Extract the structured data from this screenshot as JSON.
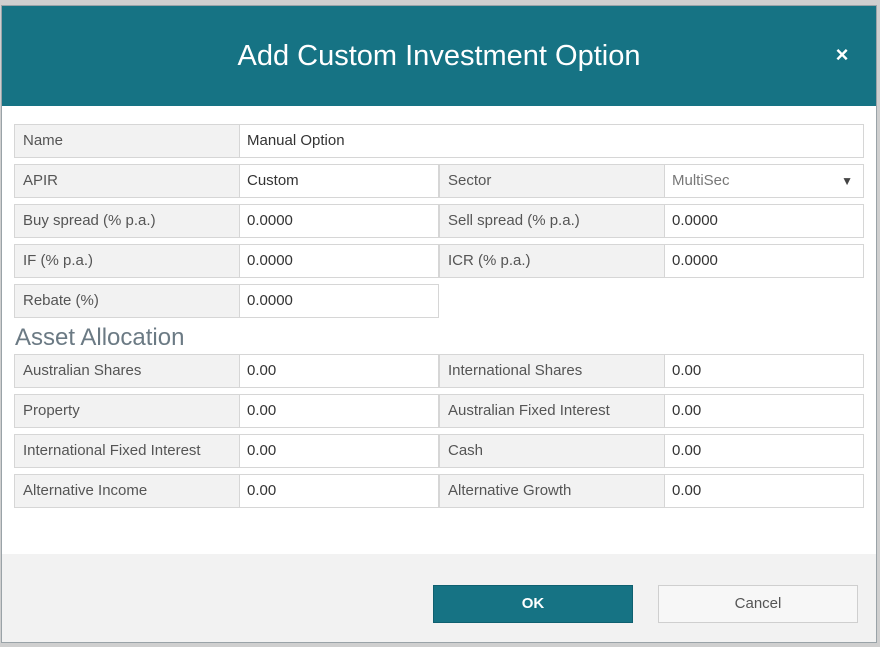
{
  "dialog": {
    "title": "Add Custom Investment Option",
    "close_glyph": "×"
  },
  "details": {
    "name": {
      "label": "Name",
      "value": "Manual Option"
    },
    "apir": {
      "label": "APIR",
      "value": "Custom"
    },
    "sector": {
      "label": "Sector",
      "value": "MultiSec",
      "caret": "▼"
    },
    "buy_spread": {
      "label": "Buy spread (% p.a.)",
      "value": "0.0000"
    },
    "sell_spread": {
      "label": "Sell spread (% p.a.)",
      "value": "0.0000"
    },
    "if": {
      "label": "IF (% p.a.)",
      "value": "0.0000"
    },
    "icr": {
      "label": "ICR (% p.a.)",
      "value": "0.0000"
    },
    "rebate": {
      "label": "Rebate (%)",
      "value": "0.0000"
    }
  },
  "asset_allocation": {
    "heading": "Asset Allocation",
    "australian_shares": {
      "label": "Australian Shares",
      "value": "0.00"
    },
    "international_shares": {
      "label": "International Shares",
      "value": "0.00"
    },
    "property": {
      "label": "Property",
      "value": "0.00"
    },
    "australian_fixed_interest": {
      "label": "Australian Fixed Interest",
      "value": "0.00"
    },
    "international_fixed_interest": {
      "label": "International Fixed Interest",
      "value": "0.00"
    },
    "cash": {
      "label": "Cash",
      "value": "0.00"
    },
    "alternative_income": {
      "label": "Alternative Income",
      "value": "0.00"
    },
    "alternative_growth": {
      "label": "Alternative Growth",
      "value": "0.00"
    }
  },
  "footer": {
    "ok_label": "OK",
    "cancel_label": "Cancel"
  },
  "colors": {
    "header": "#167384",
    "ok_button": "#167384",
    "label_bg": "#f2f2f2"
  },
  "icons": {
    "close": "close-icon",
    "dropdown": "chevron-down-icon"
  }
}
